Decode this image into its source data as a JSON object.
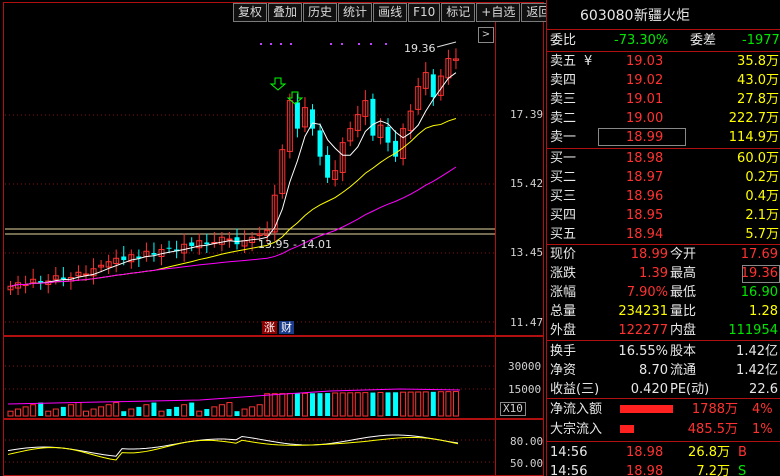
{
  "toolbar": {
    "buttons": [
      "复权",
      "叠加",
      "历史",
      "统计",
      "画线",
      "F10",
      "标记",
      "+自选",
      "返回"
    ]
  },
  "stock": {
    "code": "603080",
    "name": "新疆火炬"
  },
  "price_axis": [
    "17.39",
    "15.42",
    "13.45",
    "11.47"
  ],
  "volume_axis": [
    "30000",
    "15000",
    "X10"
  ],
  "indicator_axis": [
    "80.00",
    "50.00"
  ],
  "chart_annotations": {
    "high_label": "19.36",
    "range_label": "13.95 - 14.01",
    "tag_zhang": "涨",
    "tag_cai": "财"
  },
  "order_book": {
    "weibi": {
      "label": "委比",
      "value": "-73.30%"
    },
    "weicha": {
      "label": "委差",
      "value": "-1977"
    },
    "sell": [
      {
        "label": "卖五",
        "mark": "¥",
        "price": "19.03",
        "vol": "35.8万"
      },
      {
        "label": "卖四",
        "mark": "",
        "price": "19.02",
        "vol": "43.0万"
      },
      {
        "label": "卖三",
        "mark": "",
        "price": "19.01",
        "vol": "27.8万"
      },
      {
        "label": "卖二",
        "mark": "",
        "price": "19.00",
        "vol": "222.7万"
      },
      {
        "label": "卖一",
        "mark": "",
        "price": "18.99",
        "vol": "114.9万"
      }
    ],
    "buy": [
      {
        "label": "买一",
        "price": "18.98",
        "vol": "60.0万"
      },
      {
        "label": "买二",
        "price": "18.97",
        "vol": "0.2万"
      },
      {
        "label": "买三",
        "price": "18.96",
        "vol": "0.4万"
      },
      {
        "label": "买四",
        "price": "18.95",
        "vol": "2.1万"
      },
      {
        "label": "买五",
        "price": "18.94",
        "vol": "5.7万"
      }
    ]
  },
  "quote": [
    {
      "l1": "现价",
      "v1": "18.99",
      "l2": "今开",
      "v2": "17.69"
    },
    {
      "l1": "涨跌",
      "v1": "1.39",
      "l2": "最高",
      "v2": "19.36"
    },
    {
      "l1": "涨幅",
      "v1": "7.90%",
      "l2": "最低",
      "v2": "16.90"
    },
    {
      "l1": "总量",
      "v1": "234231",
      "l2": "量比",
      "v2": "1.28"
    },
    {
      "l1": "外盘",
      "v1": "122277",
      "l2": "内盘",
      "v2": "111954"
    }
  ],
  "fundamentals": [
    {
      "l1": "换手",
      "v1": "16.55%",
      "l2": "股本",
      "v2": "1.42亿"
    },
    {
      "l1": "净资",
      "v1": "8.70",
      "l2": "流通",
      "v2": "1.42亿"
    },
    {
      "l1": "收益(三)",
      "v1": "0.420",
      "l2": "PE(动)",
      "v2": "22.6"
    }
  ],
  "fund_flow": [
    {
      "label": "净流入额",
      "value": "1788万",
      "pct": "4%",
      "bar": 0.95
    },
    {
      "label": "大宗流入",
      "value": "485.5万",
      "pct": "1%",
      "bar": 0.25
    }
  ],
  "ticks": [
    {
      "time": "14:56",
      "price": "18.98",
      "vol": "26.8万",
      "side": "B"
    },
    {
      "time": "14:56",
      "price": "18.98",
      "vol": "7.2万",
      "side": "S"
    }
  ],
  "colors": {
    "up": "#ff3232",
    "down": "#00ffff",
    "frame": "#b01010",
    "ma_white": "#ffffff",
    "ma_yellow": "#ffff00",
    "ma_magenta": "#ff00ff"
  }
}
